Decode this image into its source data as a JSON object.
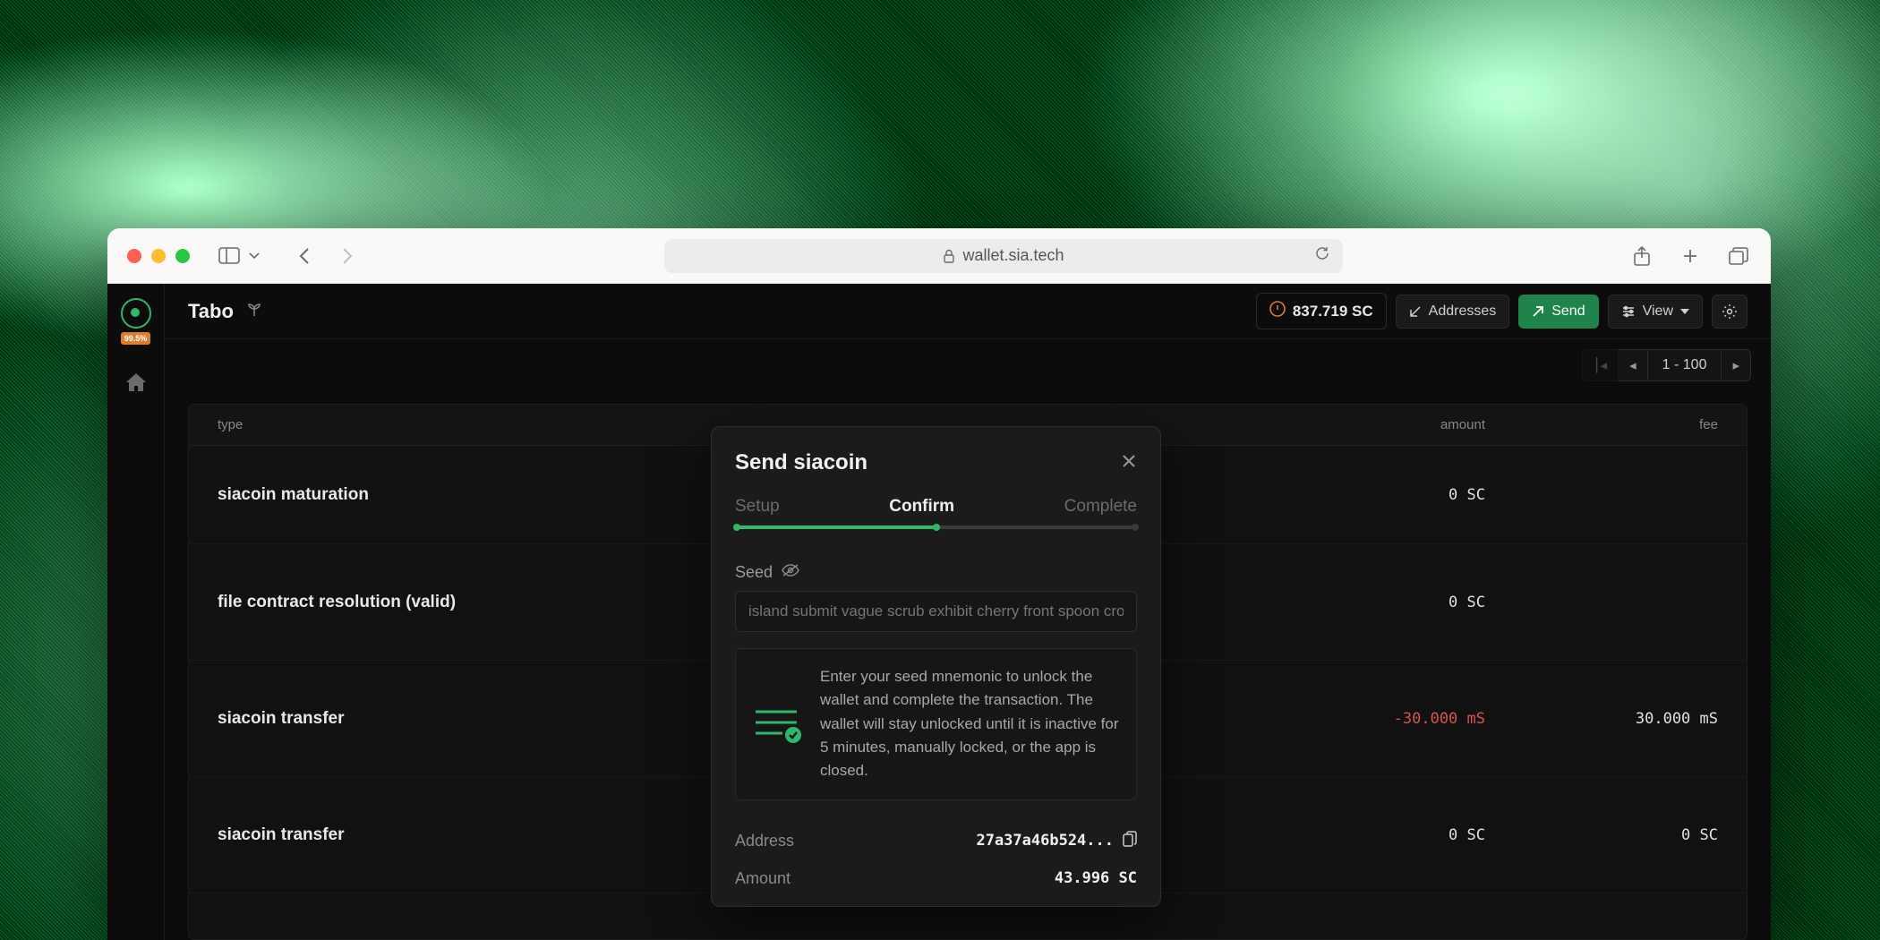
{
  "browser": {
    "url": "wallet.sia.tech"
  },
  "sidebar": {
    "badge": "99.5%"
  },
  "header": {
    "title": "Tabo",
    "balance": "837.719 SC",
    "addresses_label": "Addresses",
    "send_label": "Send",
    "view_label": "View"
  },
  "pagination": {
    "range": "1 - 100"
  },
  "table": {
    "cols": {
      "type": "type",
      "amount": "amount",
      "fee": "fee"
    },
    "rows": [
      {
        "type": "siacoin maturation",
        "amount": "0 SC",
        "fee": ""
      },
      {
        "type": "file contract resolution (valid)",
        "amount": "0 SC",
        "fee": ""
      },
      {
        "type": "siacoin transfer",
        "amount": "-30.000 mS",
        "amount_neg": true,
        "fee": "30.000 mS"
      },
      {
        "type": "siacoin transfer",
        "amount": "0 SC",
        "fee": "0 SC"
      }
    ]
  },
  "modal": {
    "title": "Send siacoin",
    "steps": {
      "setup": "Setup",
      "confirm": "Confirm",
      "complete": "Complete"
    },
    "seed_label": "Seed",
    "seed_placeholder": "island submit vague scrub exhibit cherry front spoon cro",
    "info_text": "Enter your seed mnemonic to unlock the wallet and complete the transaction. The wallet will stay unlocked until it is inactive for 5 minutes, manually locked, or the app is closed.",
    "address_label": "Address",
    "address_value": "27a37a46b524...",
    "amount_label": "Amount",
    "amount_value": "43.996 SC"
  }
}
